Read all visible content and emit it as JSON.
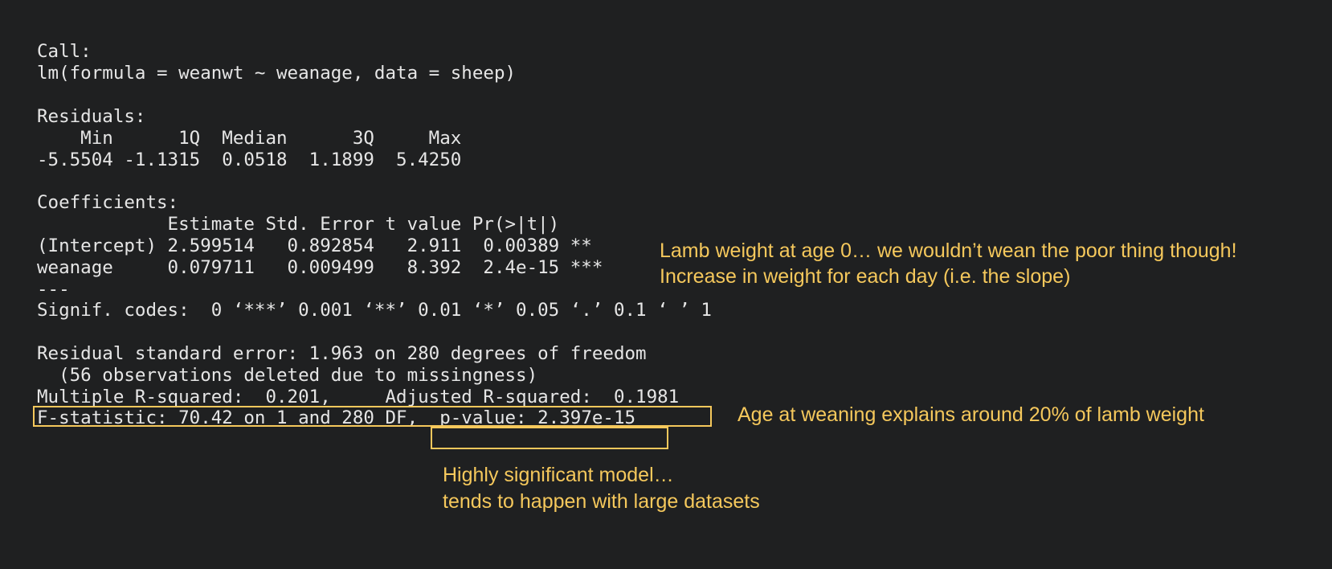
{
  "colors": {
    "background": "#1f2021",
    "console_text": "#e6e6e6",
    "annotation": "#f5c85c"
  },
  "console": {
    "call_header": "Call:",
    "call_formula": "lm(formula = weanwt ~ weanage, data = sheep)",
    "residuals_header": "Residuals:",
    "residuals_labels": "    Min      1Q  Median      3Q     Max ",
    "residuals_values": "-5.5504 -1.1315  0.0518  1.1899  5.4250 ",
    "coefficients_header": "Coefficients:",
    "coef_columns": "            Estimate Std. Error t value Pr(>|t|)    ",
    "coef_intercept": "(Intercept) 2.599514   0.892854   2.911  0.00389 ** ",
    "coef_weanage": "weanage     0.079711   0.009499   8.392  2.4e-15 ***",
    "separator": "---",
    "signif_codes": "Signif. codes:  0 ‘***’ 0.001 ‘**’ 0.01 ‘*’ 0.05 ‘.’ 0.1 ‘ ’ 1",
    "residual_se": "Residual standard error: 1.963 on 280 degrees of freedom",
    "deleted_obs": "  (56 observations deleted due to missingness)",
    "r_squared": "Multiple R-squared:  0.201,\tAdjusted R-squared:  0.1981 ",
    "f_statistic_prefix": "F-statistic: 70.42 on 1 and 280 DF,",
    "p_value": "  p-value: 2.397e-15"
  },
  "annotations": {
    "intercept_note": "Lamb weight at age 0… we wouldn’t wean the poor thing though!",
    "slope_note": "Increase in weight for each day (i.e. the slope)",
    "r_squared_note": "Age at weaning explains around 20% of lamb weight",
    "p_value_note_line1": "Highly significant model…",
    "p_value_note_line2": "tends to happen with large datasets"
  }
}
